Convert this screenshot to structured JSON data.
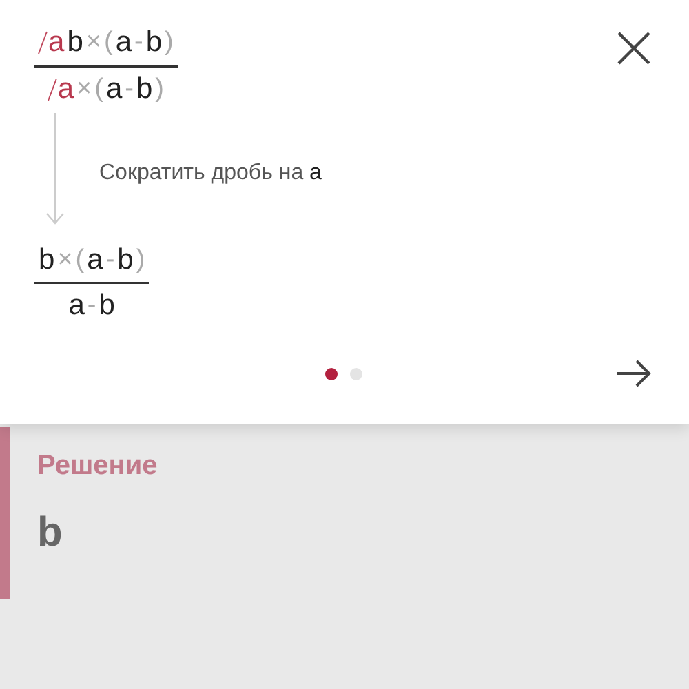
{
  "step": {
    "before": {
      "numerator": [
        {
          "text": "a",
          "kind": "cancelled"
        },
        {
          "text": "b",
          "kind": "term"
        },
        {
          "text": "×",
          "kind": "op"
        },
        {
          "text": "(",
          "kind": "op"
        },
        {
          "text": "a",
          "kind": "term"
        },
        {
          "text": "-",
          "kind": "op"
        },
        {
          "text": "b",
          "kind": "term"
        },
        {
          "text": ")",
          "kind": "op"
        }
      ],
      "denominator": [
        {
          "text": "a",
          "kind": "cancelled"
        },
        {
          "text": "×",
          "kind": "op"
        },
        {
          "text": "(",
          "kind": "op"
        },
        {
          "text": "a",
          "kind": "term"
        },
        {
          "text": "-",
          "kind": "op"
        },
        {
          "text": "b",
          "kind": "term"
        },
        {
          "text": ")",
          "kind": "op"
        }
      ]
    },
    "caption": {
      "text": "Сократить дробь на",
      "variable": "a"
    },
    "after": {
      "numerator": [
        {
          "text": "b",
          "kind": "term"
        },
        {
          "text": "×",
          "kind": "op"
        },
        {
          "text": "(",
          "kind": "op"
        },
        {
          "text": "a",
          "kind": "term"
        },
        {
          "text": "-",
          "kind": "op"
        },
        {
          "text": "b",
          "kind": "term"
        },
        {
          "text": ")",
          "kind": "op"
        }
      ],
      "denominator": [
        {
          "text": "a",
          "kind": "term"
        },
        {
          "text": "-",
          "kind": "op"
        },
        {
          "text": "b",
          "kind": "term"
        }
      ]
    }
  },
  "pager": [
    {
      "selected": true
    },
    {
      "selected": false
    }
  ],
  "solution": {
    "title": "Решение",
    "answer": "b"
  }
}
